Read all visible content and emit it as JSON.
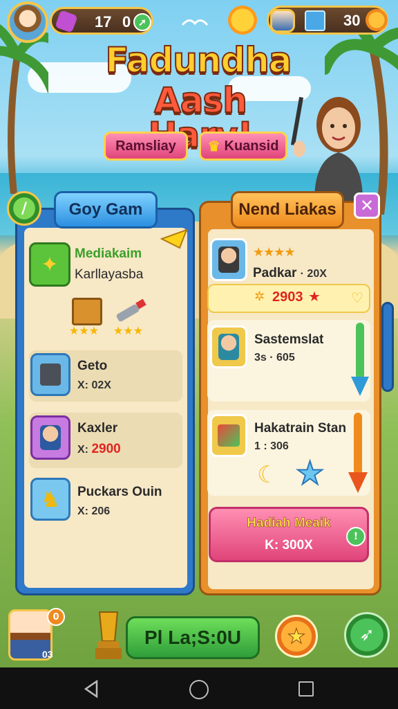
{
  "hud": {
    "left_counter": "17",
    "left_counter_b": "0",
    "right_counter": "30"
  },
  "title": {
    "line1": "Fadundha",
    "line2": "Aash Hary!"
  },
  "top_buttons": [
    {
      "label": "Ramsliay"
    },
    {
      "label": "Kuansid"
    }
  ],
  "left_panel": {
    "tab": "Goy Gam",
    "featured": {
      "name": "Mediakaim",
      "subtitle": "Karllayasba"
    },
    "items": [
      {
        "name": "Geto",
        "value": "X: 02X"
      },
      {
        "name": "Kaxler",
        "value": "X: ",
        "highlight": "2900"
      },
      {
        "name": "Puckars Ouin",
        "value": "X: 206"
      }
    ]
  },
  "right_panel": {
    "tab": "Nend Liakas",
    "items": [
      {
        "name": "Padkar",
        "extra": "· 20X",
        "price": "2903",
        "stars": 4
      },
      {
        "name": "Sastemslat",
        "value": "3s · 605"
      },
      {
        "name": "Hakatrain Stan",
        "value": "1 : 306"
      }
    ],
    "cta": {
      "label": "Hadiah Meaik",
      "value": "K: 300X"
    }
  },
  "bottom": {
    "play_label": "Pl La;S:0U",
    "profile_badge": "03",
    "notif_badge": "0"
  },
  "colors": {
    "gold": "#f6c64a",
    "blue_panel": "#2f79c9",
    "orange_panel": "#e8902b",
    "play_green": "#34b84a"
  }
}
